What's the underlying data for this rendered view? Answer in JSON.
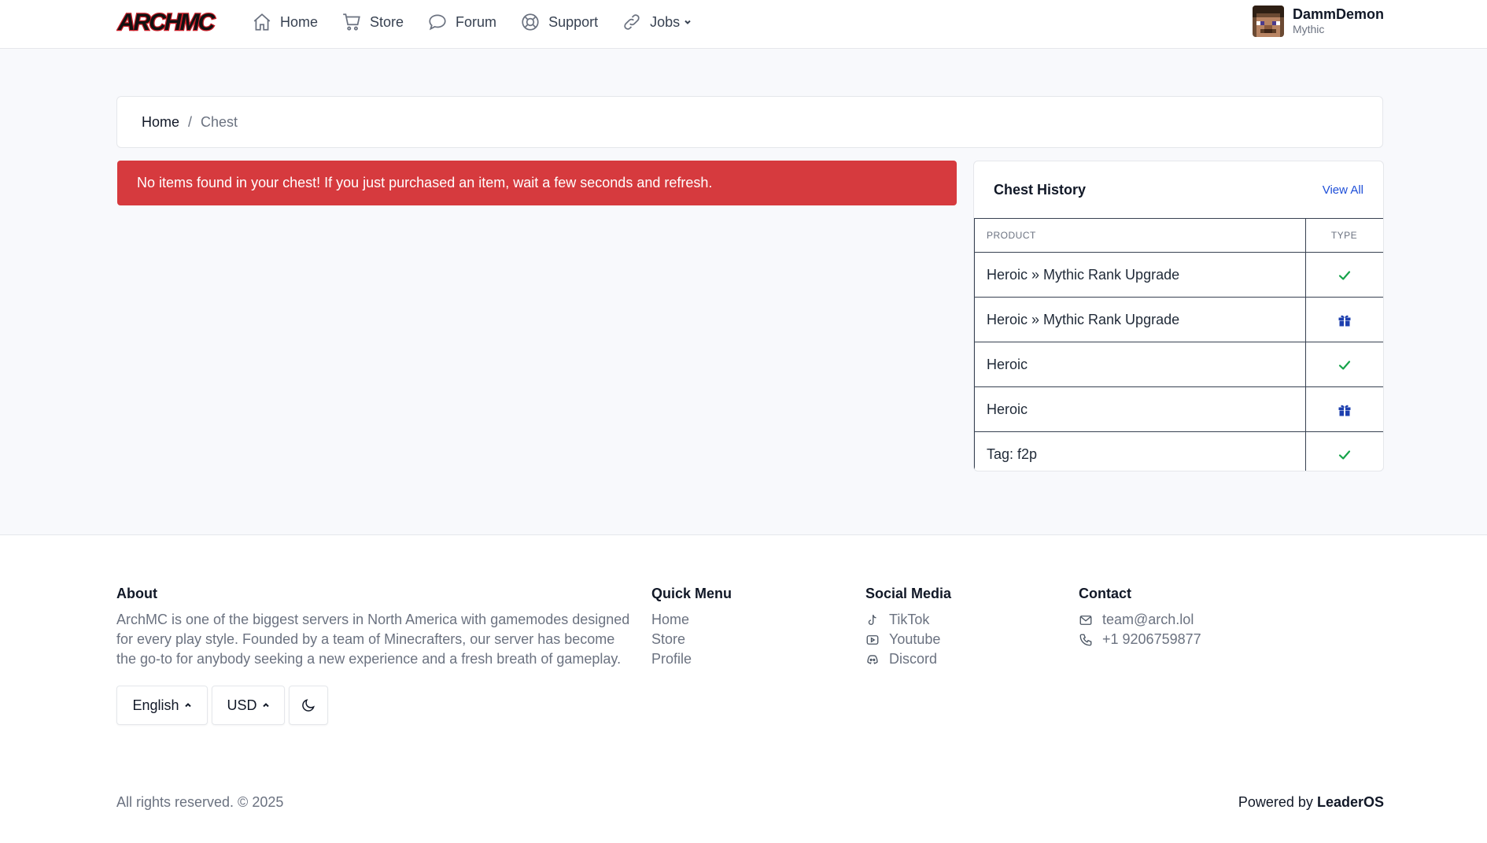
{
  "brand": {
    "logo_text": "ARCHMC"
  },
  "nav": [
    {
      "label": "Home",
      "icon": "home-icon"
    },
    {
      "label": "Store",
      "icon": "cart-icon"
    },
    {
      "label": "Forum",
      "icon": "chat-bubble-icon"
    },
    {
      "label": "Support",
      "icon": "lifebuoy-icon"
    },
    {
      "label": "Jobs",
      "icon": "link-icon"
    }
  ],
  "user": {
    "name": "DammDemon",
    "rank": "Mythic"
  },
  "breadcrumb": {
    "home": "Home",
    "separator": "/",
    "current": "Chest"
  },
  "alert": {
    "message": "No items found in your chest! If you just purchased an item, wait a few seconds and refresh.",
    "color": "#d63a3e"
  },
  "chest_history": {
    "title": "Chest History",
    "view_all": "View All",
    "columns": {
      "product": "PRODUCT",
      "type": "TYPE"
    },
    "rows": [
      {
        "product": "Heroic » Mythic Rank Upgrade",
        "type": "check-icon"
      },
      {
        "product": "Heroic » Mythic Rank Upgrade",
        "type": "gift-icon"
      },
      {
        "product": "Heroic",
        "type": "check-icon"
      },
      {
        "product": "Heroic",
        "type": "gift-icon"
      },
      {
        "product": "Tag: f2p",
        "type": "check-icon"
      }
    ]
  },
  "footer": {
    "about": {
      "title": "About",
      "text": "ArchMC is one of the biggest servers in North America with gamemodes designed for every play style. Founded by a team of Minecrafters, our server has become the go-to for anybody seeking a new experience and a fresh breath of gameplay."
    },
    "quick_menu": {
      "title": "Quick Menu",
      "links": [
        "Home",
        "Store",
        "Profile"
      ]
    },
    "social_media": {
      "title": "Social Media",
      "links": [
        {
          "label": "TikTok",
          "icon": "tiktok-icon"
        },
        {
          "label": "Youtube",
          "icon": "youtube-icon"
        },
        {
          "label": "Discord",
          "icon": "discord-icon"
        }
      ]
    },
    "contact": {
      "title": "Contact",
      "email": "team@arch.lol",
      "phone": "+1 9206759877"
    },
    "language": "English",
    "currency": "USD",
    "copyright": "All rights reserved. © 2025",
    "powered_prefix": "Powered by",
    "powered_brand": "LeaderOS"
  },
  "colors": {
    "success": "#16a34a",
    "gift": "#1e40af",
    "link": "#1d4ed8"
  }
}
